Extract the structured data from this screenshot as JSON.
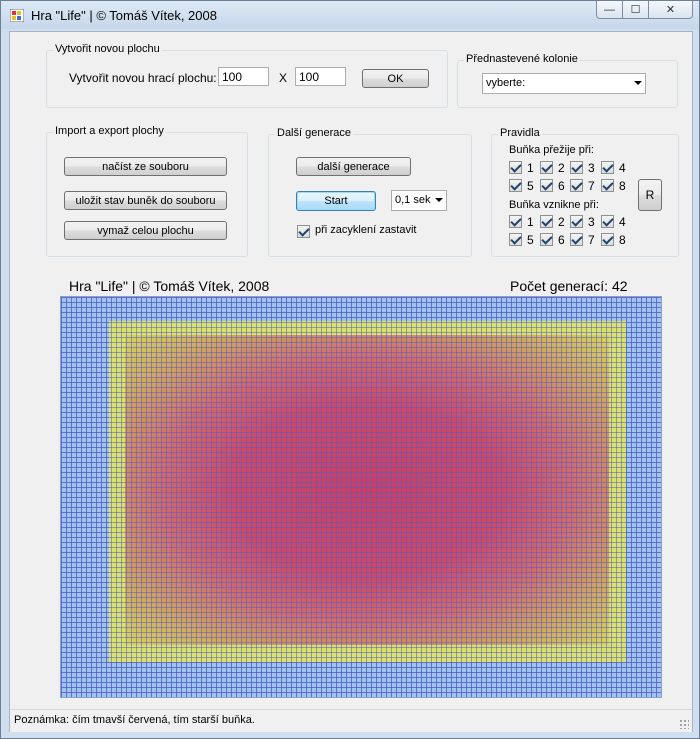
{
  "window": {
    "title": "Hra \"Life\" | © Tomáš Vítek, 2008",
    "buttons": {
      "minimize": "—",
      "maximize": "☐",
      "close": "✕"
    }
  },
  "new_board": {
    "legend": "Vytvořit novou plochu",
    "label": "Vytvořit novou hrací plochu:",
    "width_value": "100",
    "separator": "X",
    "height_value": "100",
    "ok_label": "OK"
  },
  "preset": {
    "legend": "Přednastevené  kolonie",
    "selected": "vyberte:"
  },
  "import_export": {
    "legend": "Import a export plochy",
    "load_label": "načíst ze souboru",
    "save_label": "uložit stav buněk do souboru",
    "clear_label": "vymaž celou plochu"
  },
  "next_gen": {
    "legend": "Další generace",
    "next_label": "další generace",
    "start_label": "Start",
    "speed_selected": "0,1 sek",
    "stop_on_cycle_label": "při zacyklení zastavit",
    "stop_on_cycle_checked": true
  },
  "rules": {
    "legend": "Pravidla",
    "survive_label": "Buňka přežije při:",
    "birth_label": "Buňka vznikne při:",
    "numbers_row1": [
      "1",
      "2",
      "3",
      "4"
    ],
    "numbers_row2": [
      "5",
      "6",
      "7",
      "8"
    ],
    "reset_label": "R"
  },
  "board": {
    "caption": "Hra \"Life\" | © Tomáš Vítek, 2008",
    "generations": "Počet generací: 42",
    "colors": {
      "empty": "#9fc4ec",
      "young": "#d9e36a",
      "old": "#c93f62",
      "grid": "#5a6ad0"
    }
  },
  "status": {
    "text": "Poznámka: čím tmavší červená, tím starší buňka."
  }
}
